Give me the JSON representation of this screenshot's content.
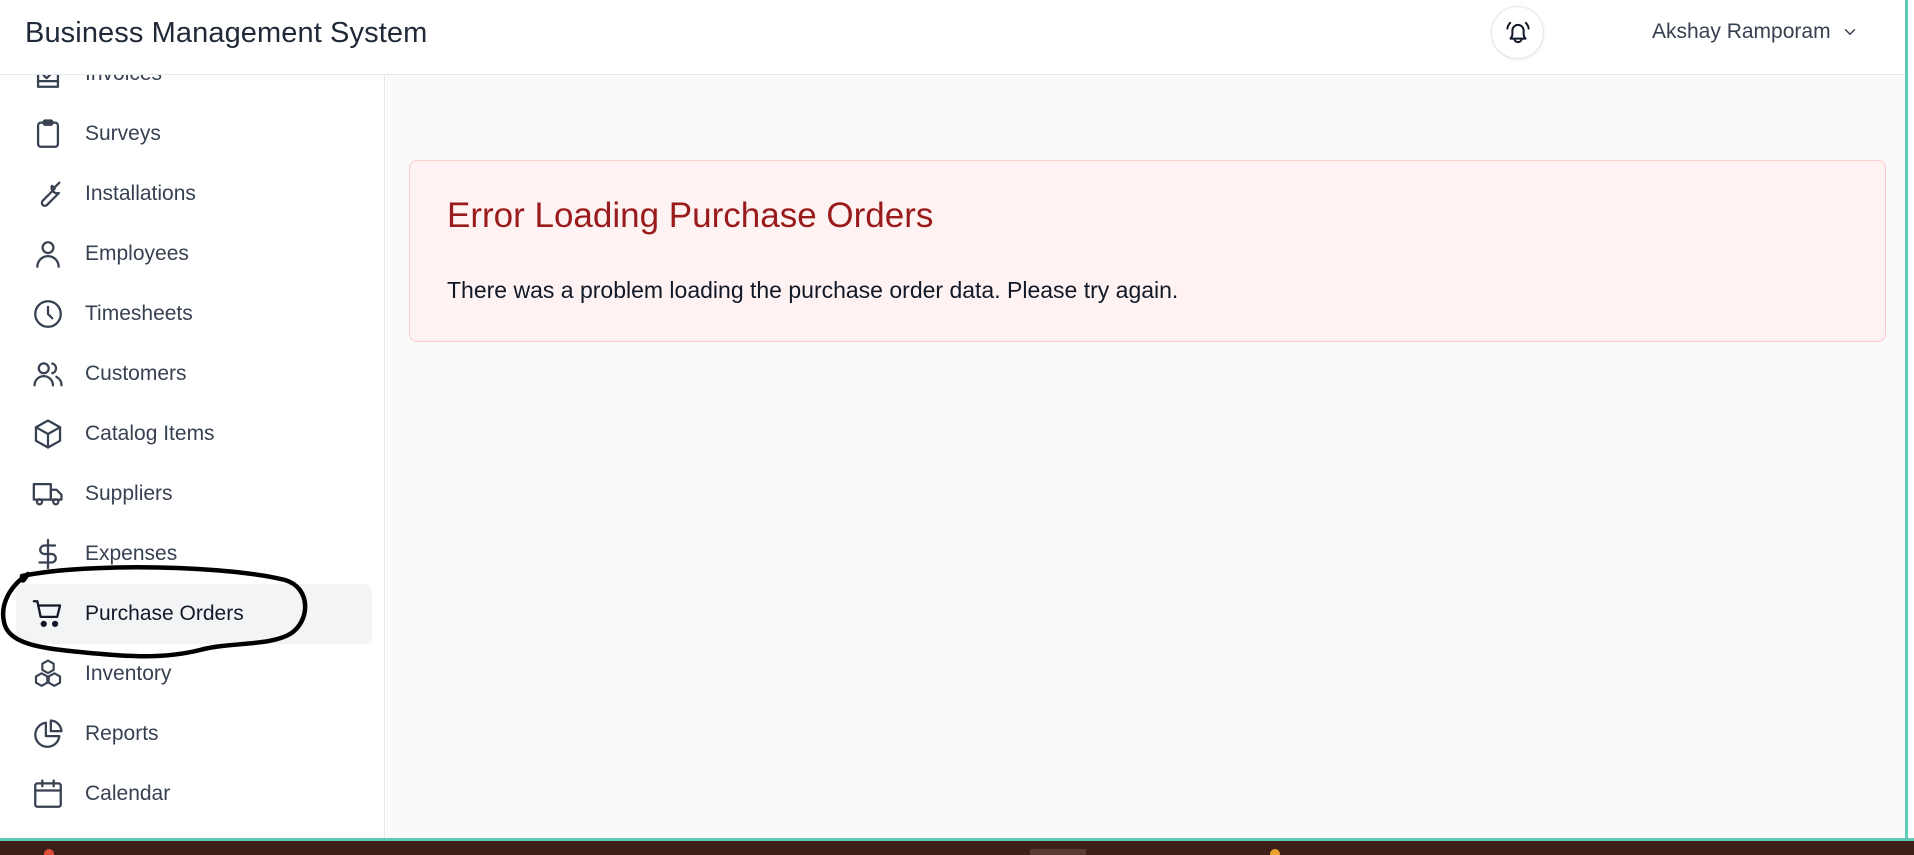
{
  "header": {
    "title": "Business Management System",
    "user_name": "Akshay Ramporam",
    "bell_icon": "bell-alert-icon"
  },
  "sidebar": {
    "items": [
      {
        "label": "Invoices",
        "icon": "invoice-icon"
      },
      {
        "label": "Surveys",
        "icon": "clipboard-icon"
      },
      {
        "label": "Installations",
        "icon": "wrench-icon"
      },
      {
        "label": "Employees",
        "icon": "user-icon"
      },
      {
        "label": "Timesheets",
        "icon": "clock-icon"
      },
      {
        "label": "Customers",
        "icon": "users-icon"
      },
      {
        "label": "Catalog Items",
        "icon": "cube-icon"
      },
      {
        "label": "Suppliers",
        "icon": "truck-icon"
      },
      {
        "label": "Expenses",
        "icon": "dollar-icon"
      },
      {
        "label": "Purchase Orders",
        "icon": "cart-icon",
        "active": true
      },
      {
        "label": "Inventory",
        "icon": "cubes-icon"
      },
      {
        "label": "Reports",
        "icon": "pie-chart-icon"
      },
      {
        "label": "Calendar",
        "icon": "calendar-icon"
      }
    ]
  },
  "main": {
    "error": {
      "title": "Error Loading Purchase Orders",
      "message": "There was a problem loading the purchase order data. Please try again."
    }
  },
  "colors": {
    "accent_border": "#5ec9b6",
    "error_bg": "#fef2f2",
    "error_title": "#991b1b",
    "active_nav_bg": "#f3f4f6"
  }
}
